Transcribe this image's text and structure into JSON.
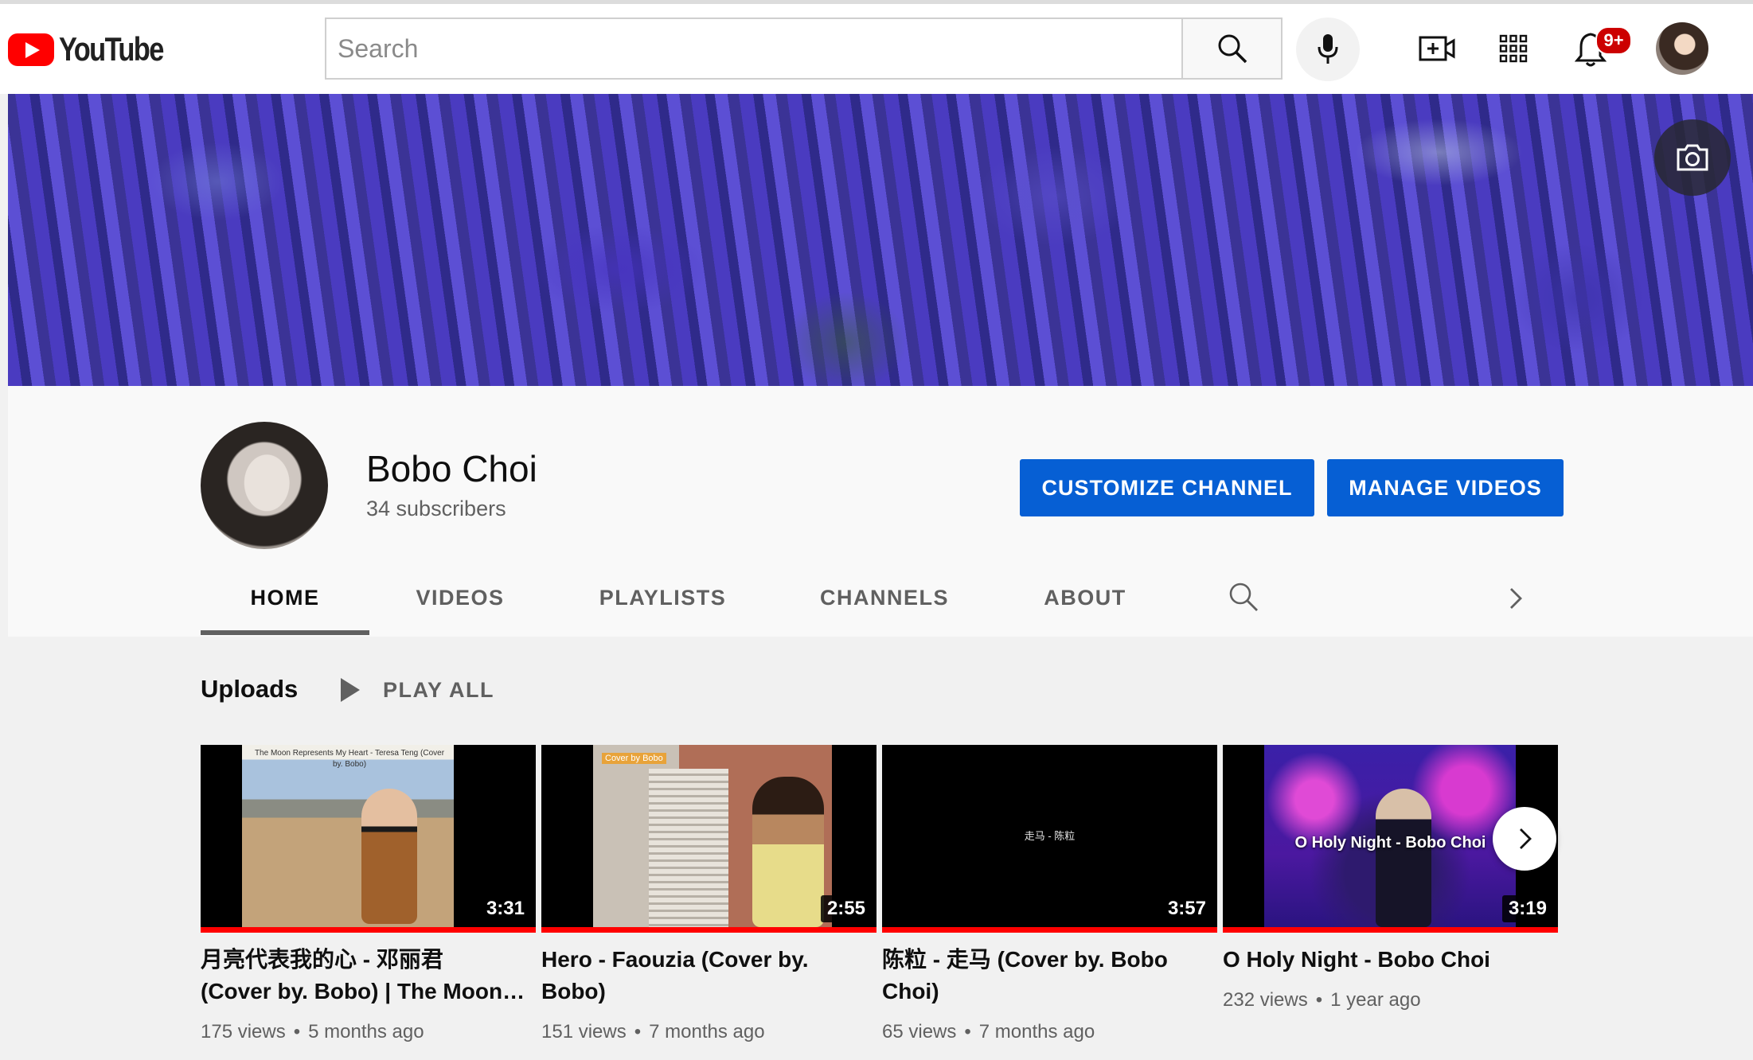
{
  "header": {
    "logo_text": "YouTube",
    "search_placeholder": "Search",
    "notification_count": "9+",
    "icons": [
      "search-icon",
      "mic-icon",
      "create-video-icon",
      "apps-grid-icon",
      "bell-icon",
      "user-avatar"
    ]
  },
  "banner": {
    "camera_icon": "camera-icon"
  },
  "channel": {
    "name": "Bobo Choi",
    "subscribers": "34 subscribers",
    "customize_label": "CUSTOMIZE CHANNEL",
    "manage_label": "MANAGE VIDEOS"
  },
  "tabs": [
    {
      "label": "HOME",
      "active": true
    },
    {
      "label": "VIDEOS"
    },
    {
      "label": "PLAYLISTS"
    },
    {
      "label": "CHANNELS"
    },
    {
      "label": "ABOUT"
    }
  ],
  "uploads": {
    "title": "Uploads",
    "play_all": "PLAY ALL",
    "videos": [
      {
        "title_line1": "月亮代表我的心 - 邓丽君",
        "title_line2": "(Cover by. Bobo) | The Moon Represents My Heart",
        "duration": "3:31",
        "views": "175 views",
        "age": "5 months ago",
        "thumb_caption": "The Moon Represents My Heart - Teresa Teng (Cover by. Bobo)"
      },
      {
        "title_line1": "Hero - Faouzia (Cover by.",
        "title_line2": "Bobo)",
        "duration": "2:55",
        "views": "151 views",
        "age": "7 months ago",
        "thumb_tag": "Cover by Bobo"
      },
      {
        "title_line1": "陈粒 - 走马 (Cover by. Bobo",
        "title_line2": "Choi)",
        "duration": "3:57",
        "views": "65 views",
        "age": "7 months ago",
        "thumb_text": "走马 - 陈粒"
      },
      {
        "title_line1": "O Holy Night - Bobo Choi",
        "title_line2": "",
        "duration": "3:19",
        "views": "232 views",
        "age": "1 year ago",
        "thumb_text": "O Holy Night - Bobo Choi"
      }
    ]
  },
  "colors": {
    "accent_blue": "#065fd4",
    "progress_red": "#ff0000",
    "logo_red": "#ff0000"
  }
}
